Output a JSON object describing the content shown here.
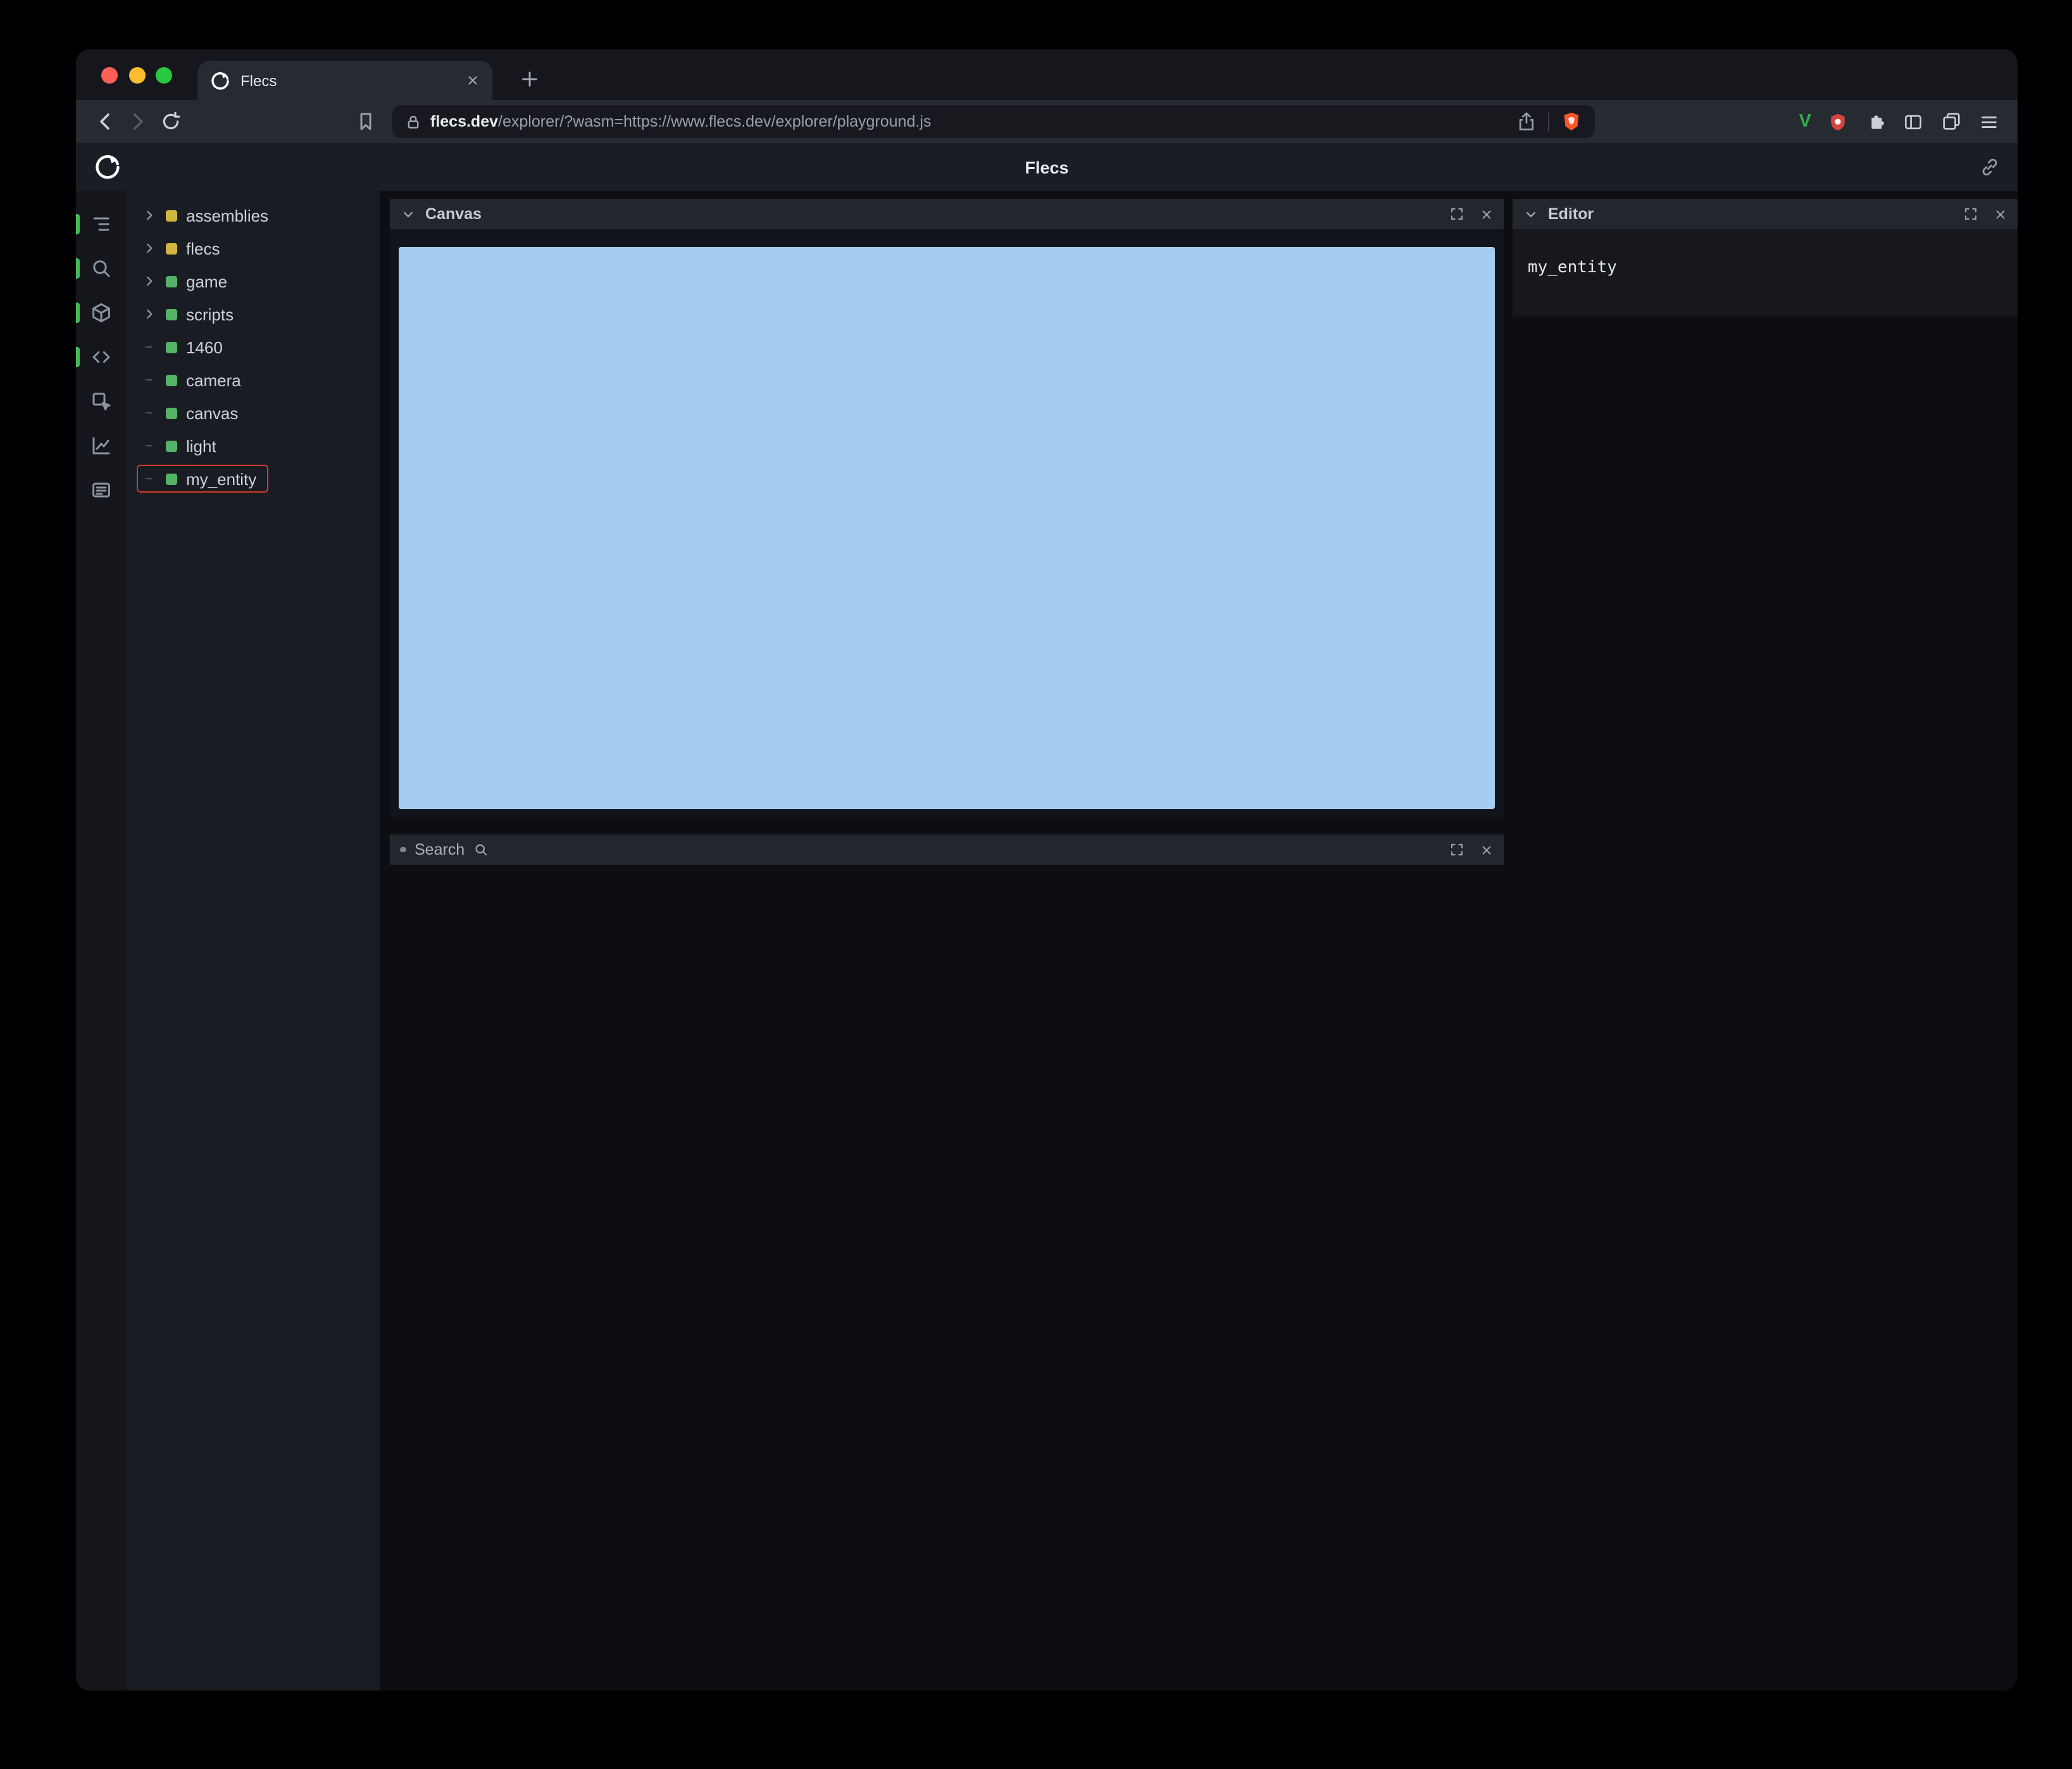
{
  "browser": {
    "tab_title": "Flecs",
    "url_host": "flecs.dev",
    "url_path": "/explorer/?wasm=https://www.flecs.dev/explorer/playground.js"
  },
  "page_header": {
    "title": "Flecs"
  },
  "sidebar": {
    "items": [
      {
        "icon": "hierarchy-icon",
        "active": true
      },
      {
        "icon": "search-icon",
        "active": true
      },
      {
        "icon": "cube-icon",
        "active": true
      },
      {
        "icon": "code-icon",
        "active": true
      },
      {
        "icon": "inspect-icon",
        "active": false
      },
      {
        "icon": "chart-icon",
        "active": false
      },
      {
        "icon": "terminal-icon",
        "active": false
      }
    ]
  },
  "tree": {
    "items": [
      {
        "label": "assemblies",
        "color": "#d2b53f",
        "expandable": true,
        "annotated": false
      },
      {
        "label": "flecs",
        "color": "#d2b53f",
        "expandable": true,
        "annotated": false
      },
      {
        "label": "game",
        "color": "#55b368",
        "expandable": true,
        "annotated": false
      },
      {
        "label": "scripts",
        "color": "#55b368",
        "expandable": true,
        "annotated": false
      },
      {
        "label": "1460",
        "color": "#55b368",
        "expandable": false,
        "annotated": false
      },
      {
        "label": "camera",
        "color": "#55b368",
        "expandable": false,
        "annotated": false
      },
      {
        "label": "canvas",
        "color": "#55b368",
        "expandable": false,
        "annotated": false
      },
      {
        "label": "light",
        "color": "#55b368",
        "expandable": false,
        "annotated": false
      },
      {
        "label": "my_entity",
        "color": "#55b368",
        "expandable": false,
        "annotated": true
      }
    ]
  },
  "panels": {
    "canvas": {
      "title": "Canvas"
    },
    "search": {
      "title": "Search"
    },
    "editor": {
      "title": "Editor",
      "content": "my_entity"
    }
  },
  "colors": {
    "annotation_red": "#d23b2a",
    "canvas_blue": "#a6cdf1",
    "active_green": "#46b85c",
    "entity_green": "#55b368",
    "module_yellow": "#d2b53f"
  }
}
